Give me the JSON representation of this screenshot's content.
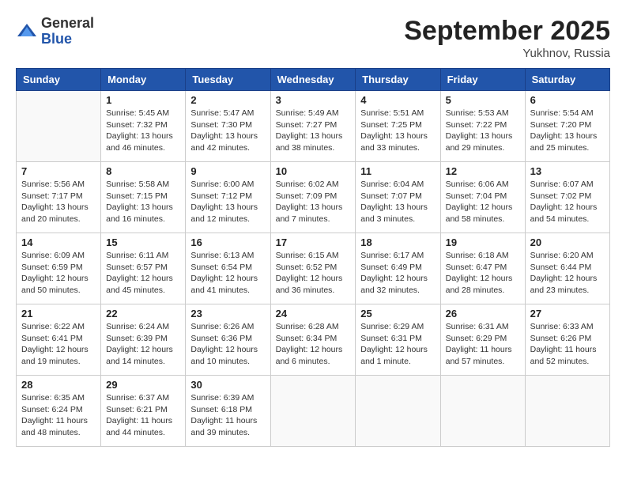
{
  "logo": {
    "general": "General",
    "blue": "Blue"
  },
  "title": "September 2025",
  "location": "Yukhnov, Russia",
  "days_of_week": [
    "Sunday",
    "Monday",
    "Tuesday",
    "Wednesday",
    "Thursday",
    "Friday",
    "Saturday"
  ],
  "weeks": [
    [
      {
        "day": "",
        "info": ""
      },
      {
        "day": "1",
        "info": "Sunrise: 5:45 AM\nSunset: 7:32 PM\nDaylight: 13 hours\nand 46 minutes."
      },
      {
        "day": "2",
        "info": "Sunrise: 5:47 AM\nSunset: 7:30 PM\nDaylight: 13 hours\nand 42 minutes."
      },
      {
        "day": "3",
        "info": "Sunrise: 5:49 AM\nSunset: 7:27 PM\nDaylight: 13 hours\nand 38 minutes."
      },
      {
        "day": "4",
        "info": "Sunrise: 5:51 AM\nSunset: 7:25 PM\nDaylight: 13 hours\nand 33 minutes."
      },
      {
        "day": "5",
        "info": "Sunrise: 5:53 AM\nSunset: 7:22 PM\nDaylight: 13 hours\nand 29 minutes."
      },
      {
        "day": "6",
        "info": "Sunrise: 5:54 AM\nSunset: 7:20 PM\nDaylight: 13 hours\nand 25 minutes."
      }
    ],
    [
      {
        "day": "7",
        "info": "Sunrise: 5:56 AM\nSunset: 7:17 PM\nDaylight: 13 hours\nand 20 minutes."
      },
      {
        "day": "8",
        "info": "Sunrise: 5:58 AM\nSunset: 7:15 PM\nDaylight: 13 hours\nand 16 minutes."
      },
      {
        "day": "9",
        "info": "Sunrise: 6:00 AM\nSunset: 7:12 PM\nDaylight: 13 hours\nand 12 minutes."
      },
      {
        "day": "10",
        "info": "Sunrise: 6:02 AM\nSunset: 7:09 PM\nDaylight: 13 hours\nand 7 minutes."
      },
      {
        "day": "11",
        "info": "Sunrise: 6:04 AM\nSunset: 7:07 PM\nDaylight: 13 hours\nand 3 minutes."
      },
      {
        "day": "12",
        "info": "Sunrise: 6:06 AM\nSunset: 7:04 PM\nDaylight: 12 hours\nand 58 minutes."
      },
      {
        "day": "13",
        "info": "Sunrise: 6:07 AM\nSunset: 7:02 PM\nDaylight: 12 hours\nand 54 minutes."
      }
    ],
    [
      {
        "day": "14",
        "info": "Sunrise: 6:09 AM\nSunset: 6:59 PM\nDaylight: 12 hours\nand 50 minutes."
      },
      {
        "day": "15",
        "info": "Sunrise: 6:11 AM\nSunset: 6:57 PM\nDaylight: 12 hours\nand 45 minutes."
      },
      {
        "day": "16",
        "info": "Sunrise: 6:13 AM\nSunset: 6:54 PM\nDaylight: 12 hours\nand 41 minutes."
      },
      {
        "day": "17",
        "info": "Sunrise: 6:15 AM\nSunset: 6:52 PM\nDaylight: 12 hours\nand 36 minutes."
      },
      {
        "day": "18",
        "info": "Sunrise: 6:17 AM\nSunset: 6:49 PM\nDaylight: 12 hours\nand 32 minutes."
      },
      {
        "day": "19",
        "info": "Sunrise: 6:18 AM\nSunset: 6:47 PM\nDaylight: 12 hours\nand 28 minutes."
      },
      {
        "day": "20",
        "info": "Sunrise: 6:20 AM\nSunset: 6:44 PM\nDaylight: 12 hours\nand 23 minutes."
      }
    ],
    [
      {
        "day": "21",
        "info": "Sunrise: 6:22 AM\nSunset: 6:41 PM\nDaylight: 12 hours\nand 19 minutes."
      },
      {
        "day": "22",
        "info": "Sunrise: 6:24 AM\nSunset: 6:39 PM\nDaylight: 12 hours\nand 14 minutes."
      },
      {
        "day": "23",
        "info": "Sunrise: 6:26 AM\nSunset: 6:36 PM\nDaylight: 12 hours\nand 10 minutes."
      },
      {
        "day": "24",
        "info": "Sunrise: 6:28 AM\nSunset: 6:34 PM\nDaylight: 12 hours\nand 6 minutes."
      },
      {
        "day": "25",
        "info": "Sunrise: 6:29 AM\nSunset: 6:31 PM\nDaylight: 12 hours\nand 1 minute."
      },
      {
        "day": "26",
        "info": "Sunrise: 6:31 AM\nSunset: 6:29 PM\nDaylight: 11 hours\nand 57 minutes."
      },
      {
        "day": "27",
        "info": "Sunrise: 6:33 AM\nSunset: 6:26 PM\nDaylight: 11 hours\nand 52 minutes."
      }
    ],
    [
      {
        "day": "28",
        "info": "Sunrise: 6:35 AM\nSunset: 6:24 PM\nDaylight: 11 hours\nand 48 minutes."
      },
      {
        "day": "29",
        "info": "Sunrise: 6:37 AM\nSunset: 6:21 PM\nDaylight: 11 hours\nand 44 minutes."
      },
      {
        "day": "30",
        "info": "Sunrise: 6:39 AM\nSunset: 6:18 PM\nDaylight: 11 hours\nand 39 minutes."
      },
      {
        "day": "",
        "info": ""
      },
      {
        "day": "",
        "info": ""
      },
      {
        "day": "",
        "info": ""
      },
      {
        "day": "",
        "info": ""
      }
    ]
  ]
}
